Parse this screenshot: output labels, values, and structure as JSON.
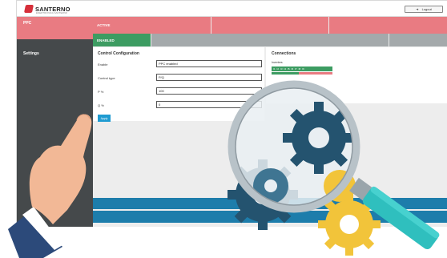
{
  "brand": {
    "name": "SANTERNO",
    "tagline": "ENERTRONICA SANTERNO"
  },
  "header": {
    "logout_label": "Logout"
  },
  "sidebar": {
    "items": [
      {
        "label": "PPC",
        "active": true
      },
      {
        "label": "Settings",
        "active": false
      }
    ]
  },
  "status": {
    "active_label": "ACTIVE",
    "enabled_label": "ENABLED"
  },
  "control_configuration": {
    "title": "Control Configuration",
    "fields": [
      {
        "label": "Enable",
        "value": "PPC enabled"
      },
      {
        "label": "Control type",
        "value": "P/Q"
      },
      {
        "label": "P %",
        "value": "100"
      },
      {
        "label": "Q %",
        "value": "0"
      }
    ],
    "apply_label": "Apply"
  },
  "connections": {
    "title": "Connections",
    "inverters_label": "Inverters",
    "inverters": [
      "I1",
      "I2",
      "I3",
      "I4",
      "I5",
      "I6",
      "I7",
      "I8",
      "I9"
    ]
  },
  "colors": {
    "accent_red": "#e97b82",
    "accent_green": "#3d9c62",
    "sidebar_bg": "#45494b",
    "accent_blue": "#1d7dab",
    "magnifier_teal": "#2fbfbe",
    "gear_navy": "#24536f",
    "gear_yellow": "#f2c43a"
  },
  "icons": [
    "logout-icon",
    "magnifying-glass-icon",
    "gear-icon",
    "pointing-hand-icon"
  ]
}
